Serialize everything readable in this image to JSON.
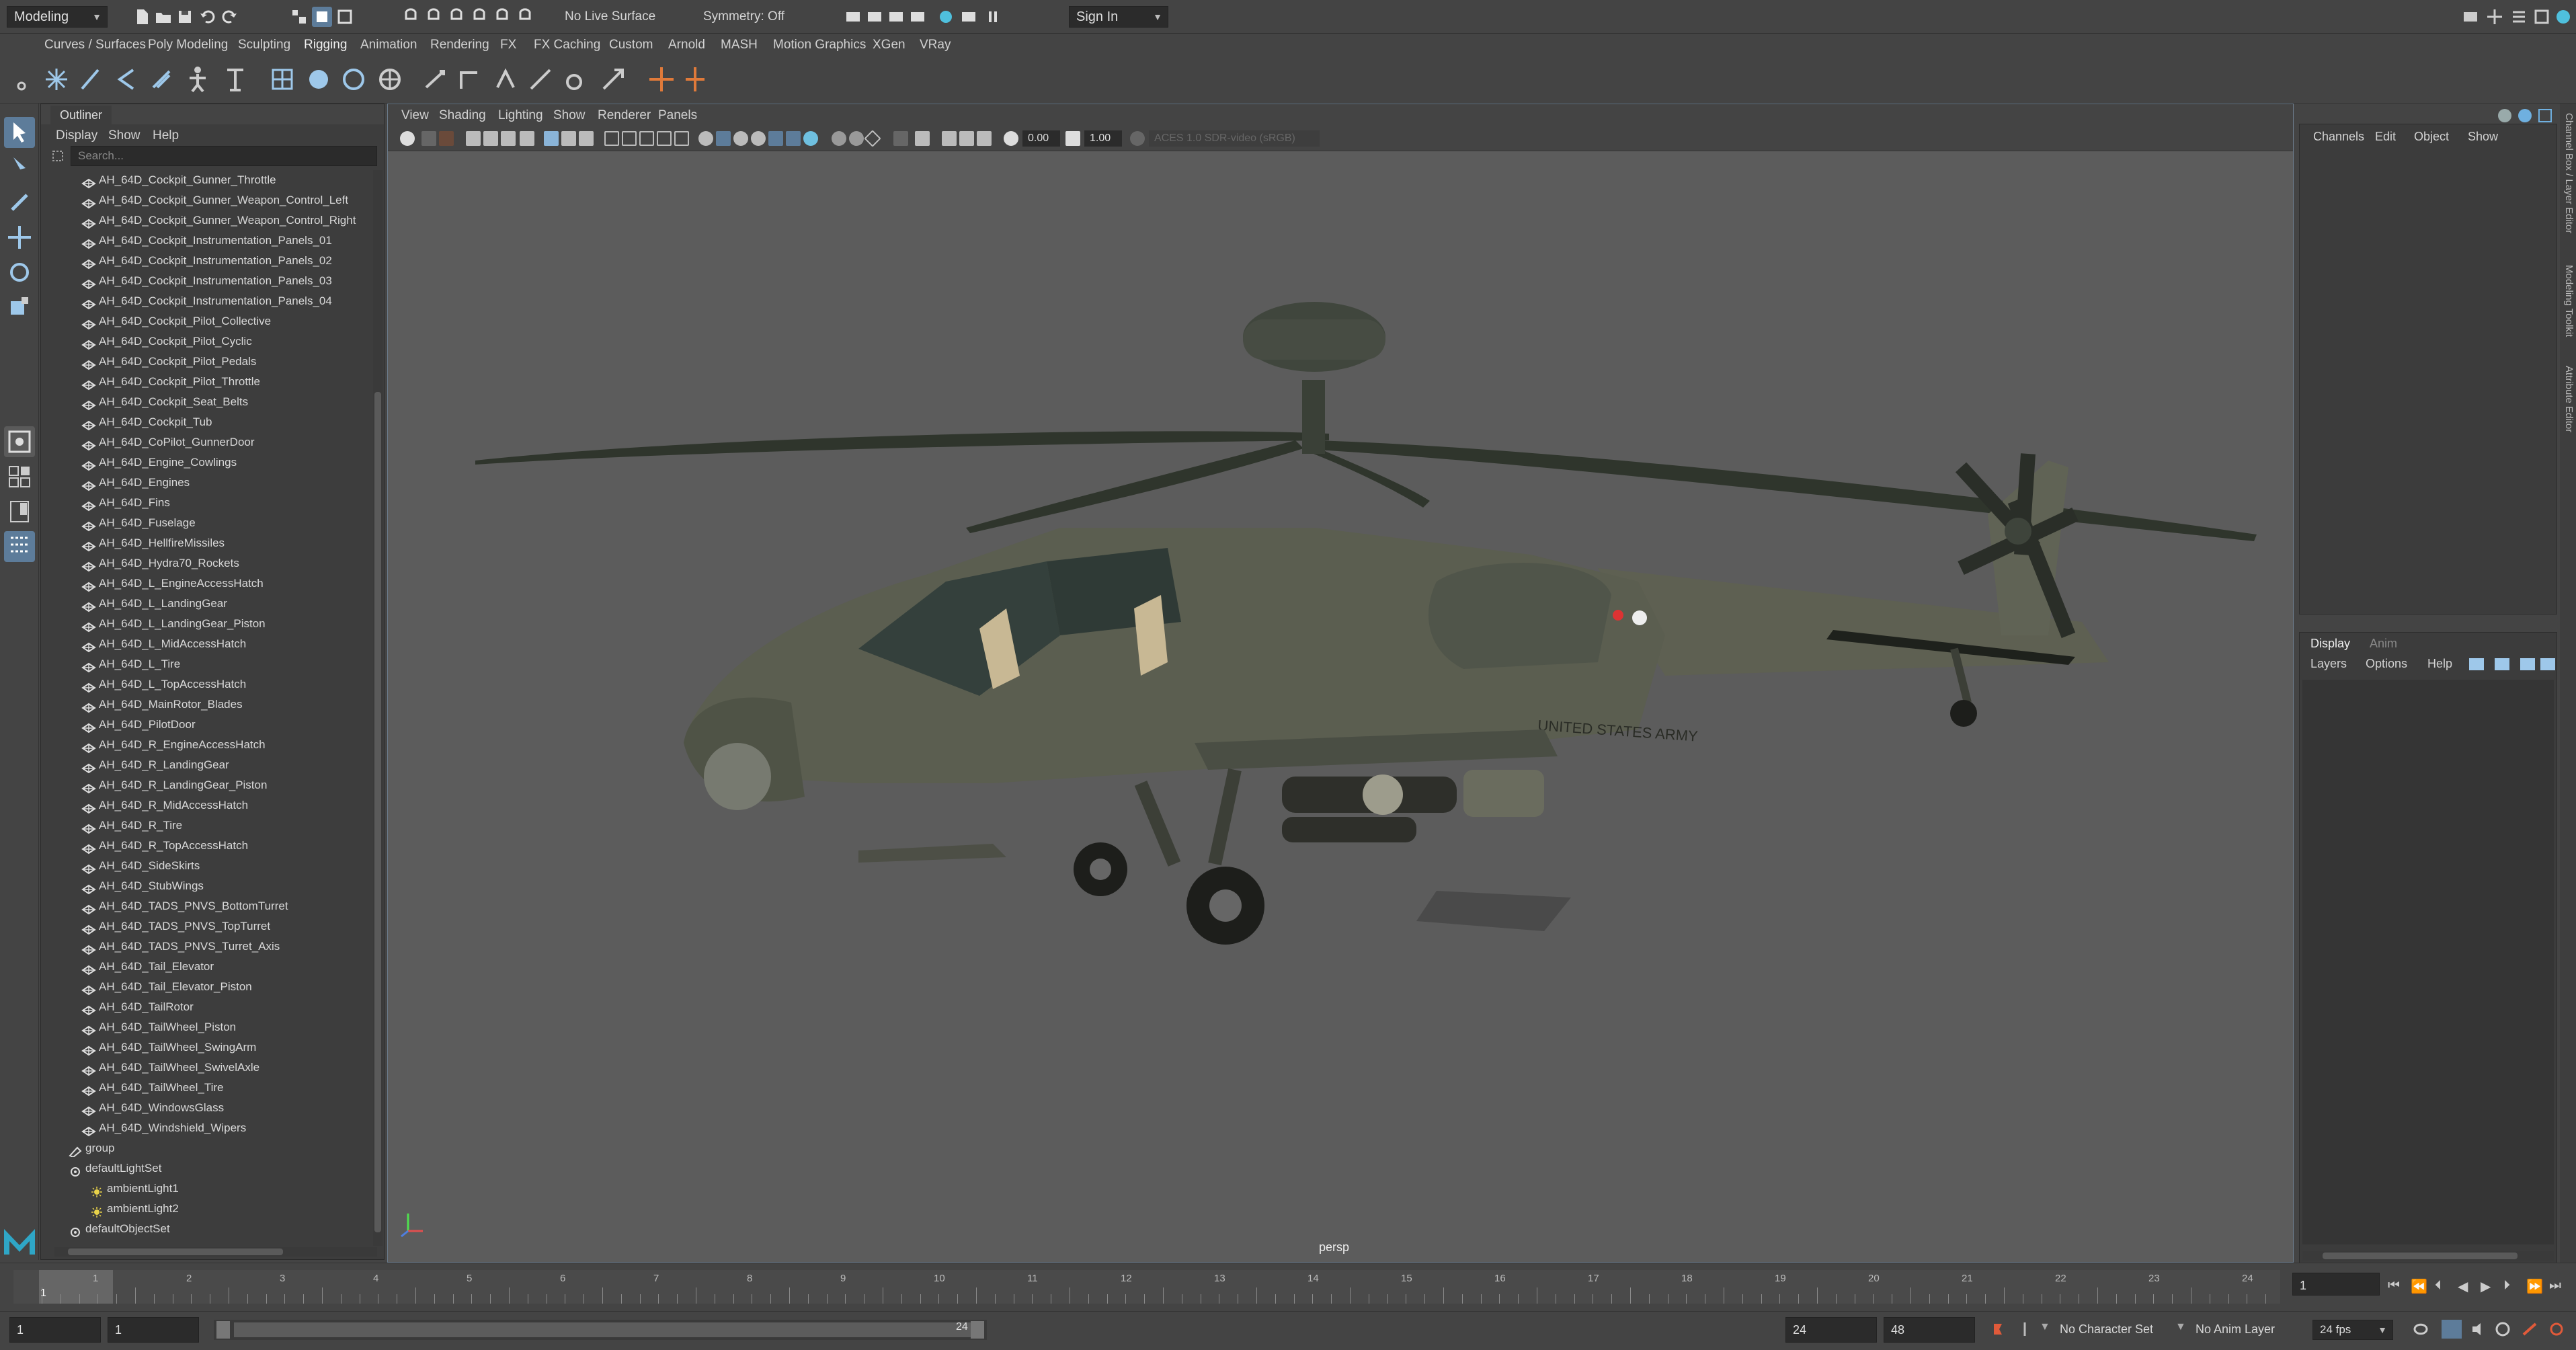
{
  "status_line": {
    "mode": "Modeling",
    "live_surface": "No Live Surface",
    "symmetry": "Symmetry: Off",
    "sign_in": "Sign In"
  },
  "menu_bar": {
    "items": [
      "Curves / Surfaces",
      "Poly Modeling",
      "Sculpting",
      "Rigging",
      "Animation",
      "Rendering",
      "FX",
      "FX Caching",
      "Custom",
      "Arnold",
      "MASH",
      "Motion Graphics",
      "XGen",
      "VRay"
    ]
  },
  "outliner": {
    "tab": "Outliner",
    "menus": [
      "Display",
      "Show",
      "Help"
    ],
    "search_placeholder": "Search...",
    "items": [
      "AH_64D_Cockpit_Gunner_Throttle",
      "AH_64D_Cockpit_Gunner_Weapon_Control_Left",
      "AH_64D_Cockpit_Gunner_Weapon_Control_Right",
      "AH_64D_Cockpit_Instrumentation_Panels_01",
      "AH_64D_Cockpit_Instrumentation_Panels_02",
      "AH_64D_Cockpit_Instrumentation_Panels_03",
      "AH_64D_Cockpit_Instrumentation_Panels_04",
      "AH_64D_Cockpit_Pilot_Collective",
      "AH_64D_Cockpit_Pilot_Cyclic",
      "AH_64D_Cockpit_Pilot_Pedals",
      "AH_64D_Cockpit_Pilot_Throttle",
      "AH_64D_Cockpit_Seat_Belts",
      "AH_64D_Cockpit_Tub",
      "AH_64D_CoPilot_GunnerDoor",
      "AH_64D_Engine_Cowlings",
      "AH_64D_Engines",
      "AH_64D_Fins",
      "AH_64D_Fuselage",
      "AH_64D_HellfireMissiles",
      "AH_64D_Hydra70_Rockets",
      "AH_64D_L_EngineAccessHatch",
      "AH_64D_L_LandingGear",
      "AH_64D_L_LandingGear_Piston",
      "AH_64D_L_MidAccessHatch",
      "AH_64D_L_Tire",
      "AH_64D_L_TopAccessHatch",
      "AH_64D_MainRotor_Blades",
      "AH_64D_PilotDoor",
      "AH_64D_R_EngineAccessHatch",
      "AH_64D_R_LandingGear",
      "AH_64D_R_LandingGear_Piston",
      "AH_64D_R_MidAccessHatch",
      "AH_64D_R_Tire",
      "AH_64D_R_TopAccessHatch",
      "AH_64D_SideSkirts",
      "AH_64D_StubWings",
      "AH_64D_TADS_PNVS_BottomTurret",
      "AH_64D_TADS_PNVS_TopTurret",
      "AH_64D_TADS_PNVS_Turret_Axis",
      "AH_64D_Tail_Elevator",
      "AH_64D_Tail_Elevator_Piston",
      "AH_64D_TailRotor",
      "AH_64D_TailWheel_Piston",
      "AH_64D_TailWheel_SwingArm",
      "AH_64D_TailWheel_SwivelAxle",
      "AH_64D_TailWheel_Tire",
      "AH_64D_WindowsGlass",
      "AH_64D_Windshield_Wipers"
    ],
    "group": "group",
    "light_set": "defaultLightSet",
    "lights": [
      "ambientLight1",
      "ambientLight2"
    ],
    "object_set": "defaultObjectSet"
  },
  "viewport": {
    "menus": [
      "View",
      "Shading",
      "Lighting",
      "Show",
      "Renderer",
      "Panels"
    ],
    "field_a": "0.00",
    "field_b": "1.00",
    "color_space": "ACES 1.0 SDR-video (sRGB)",
    "camera": "persp",
    "fuselage_text": "UNITED STATES ARMY"
  },
  "channel_box": {
    "menus": [
      "Channels",
      "Edit",
      "Object",
      "Show"
    ],
    "layer_tabs": [
      "Display",
      "Anim"
    ],
    "layer_menus": [
      "Layers",
      "Options",
      "Help"
    ]
  },
  "side_tabs": [
    "Channel Box / Layer Editor",
    "Modeling Toolkit",
    "Attribute Editor"
  ],
  "timeline": {
    "ticks": [
      "1",
      "2",
      "3",
      "4",
      "5",
      "6",
      "7",
      "8",
      "9",
      "10",
      "11",
      "12",
      "13",
      "14",
      "15",
      "16",
      "17",
      "18",
      "19",
      "20",
      "21",
      "22",
      "23",
      "24"
    ],
    "current_frame": "1",
    "current_frame_field": "1"
  },
  "range": {
    "start": "1",
    "anim_start": "1",
    "slider_start": "1",
    "slider_end": "24",
    "end": "24",
    "anim_end": "48",
    "character_set": "No Character Set",
    "anim_layer": "No Anim Layer",
    "fps": "24 fps"
  },
  "colors": {
    "accent": "#5d7c9a",
    "maya_logo": "#2fa6c6",
    "key_red": "#e05a3a"
  }
}
